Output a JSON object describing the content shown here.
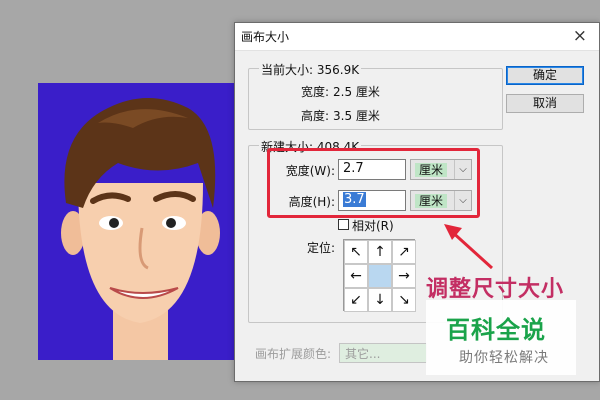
{
  "dialog": {
    "title": "画布大小",
    "close_symbol": "×",
    "ok_label": "确定",
    "cancel_label": "取消",
    "current_size": {
      "legend": "当前大小: 356.9K",
      "width_label": "宽度:",
      "width_value": "2.5 厘米",
      "height_label": "高度:",
      "height_value": "3.5 厘米"
    },
    "new_size": {
      "legend": "新建大小: 408.4K",
      "width_label": "宽度(W):",
      "width_value": "2.7",
      "width_unit": "厘米",
      "height_label": "高度(H):",
      "height_value": "3.7",
      "height_unit": "厘米",
      "relative_label": "相对(R)",
      "relative_checked": false,
      "anchor_label": "定位:",
      "anchor_arrows": [
        "↖",
        "↑",
        "↗",
        "←",
        "",
        "→",
        "↙",
        "↓",
        "↘"
      ]
    },
    "extension_color_label": "画布扩展颜色:",
    "extension_color_value": "其它..."
  },
  "annotation": {
    "text": "调整尺寸大小",
    "color": "#c32e63",
    "highlight_color": "#e2263a"
  },
  "watermark": {
    "title": "百科全说",
    "subtitle": "助你轻松解决"
  },
  "colors": {
    "photo_background": "#3a1ec9"
  }
}
